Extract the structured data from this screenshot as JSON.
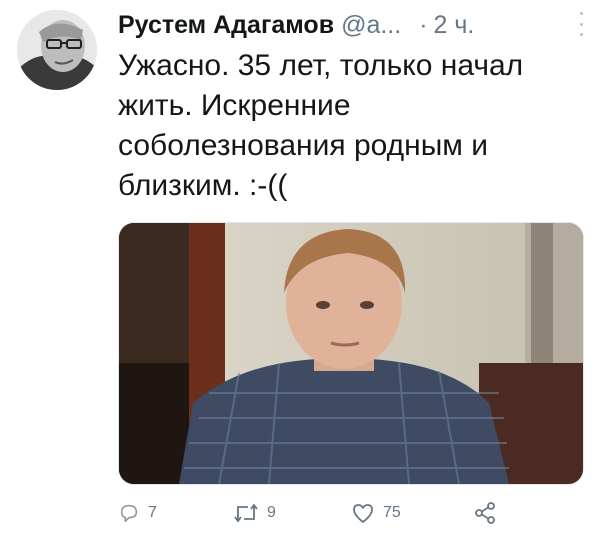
{
  "tweet": {
    "author_name": "Рустем Адагамов",
    "author_handle": "@a...",
    "separator": "·",
    "time": "2 ч.",
    "text": "Ужасно. 35 лет, только начал\nжить. Искренние\nсоболезнования родным и\nблизким. :-(("
  },
  "icons": {
    "more": "more-vertical-icon",
    "reply": "reply-icon",
    "retweet": "retweet-icon",
    "like": "heart-icon",
    "share": "share-icon"
  },
  "actions": {
    "reply_count": "7",
    "retweet_count": "9",
    "like_count": "75"
  },
  "colors": {
    "text": "#14171a",
    "muted": "#657786",
    "border": "#e1e8ed"
  }
}
